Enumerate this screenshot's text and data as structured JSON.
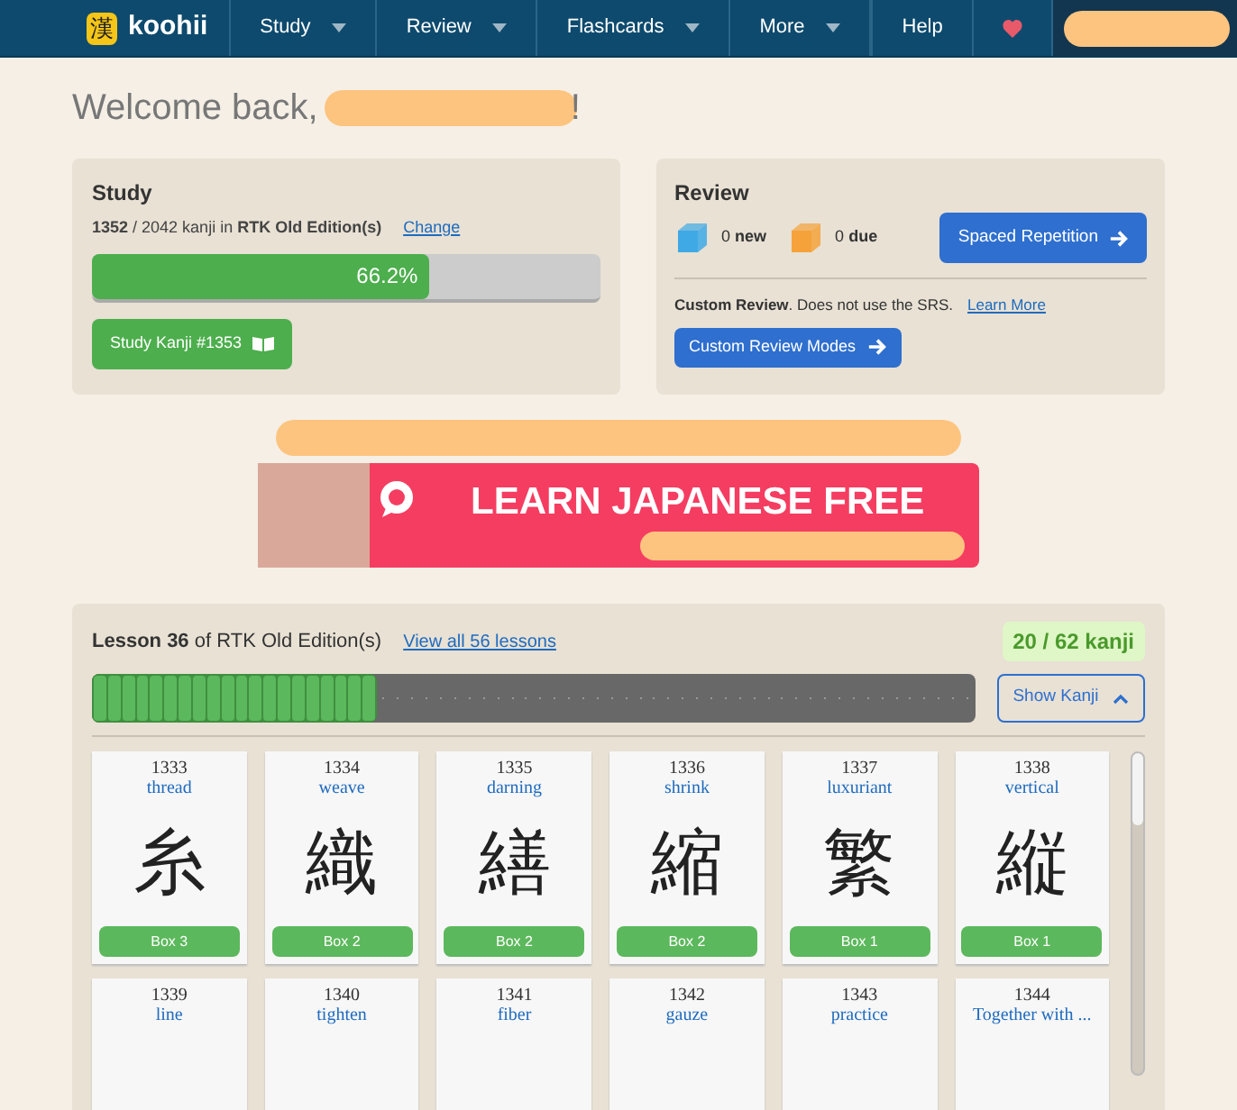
{
  "nav": {
    "logo_glyph": "漢",
    "brand": "koohii",
    "menus": [
      {
        "label": "Study"
      },
      {
        "label": "Review"
      },
      {
        "label": "Flashcards"
      },
      {
        "label": "More"
      }
    ],
    "help": "Help"
  },
  "welcome": {
    "greeting": "Welcome back,",
    "end": "!"
  },
  "study": {
    "title": "Study",
    "summary": "**1352** / 2042 kanji in **RTK Old Edition(s)**",
    "change_link": "Change",
    "level": 0.662,
    "percent": "66.2%",
    "button": "Study Kanji #1353"
  },
  "review": {
    "title": "Review",
    "counters": [
      {
        "count": "0",
        "label": "new",
        "color": "#3fa9e6"
      },
      {
        "count": "0",
        "label": "due",
        "color": "#f5a23a"
      }
    ],
    "srs_button": "Spaced Repetition",
    "custom_text": "**Custom Review**. Does not use the SRS.",
    "learn_more": "Learn More",
    "custom_button": "Custom Review Modes"
  },
  "ad": {
    "headline": "LEARN JAPANESE FREE"
  },
  "lesson": {
    "title": "**Lesson 36** of RTK Old Edition(s)",
    "view_all": "View all 56 lessons",
    "count": "20 / 62 kanji",
    "level": 0.3226,
    "show_button": "Show Kanji",
    "cards": [
      {
        "number": "1333",
        "keyword": "thread",
        "kanji": "糸",
        "box": "Box 3"
      },
      {
        "number": "1334",
        "keyword": "weave",
        "kanji": "織",
        "box": "Box 2"
      },
      {
        "number": "1335",
        "keyword": "darning",
        "kanji": "繕",
        "box": "Box 2"
      },
      {
        "number": "1336",
        "keyword": "shrink",
        "kanji": "縮",
        "box": "Box 2"
      },
      {
        "number": "1337",
        "keyword": "luxuriant",
        "kanji": "繁",
        "box": "Box 1"
      },
      {
        "number": "1338",
        "keyword": "vertical",
        "kanji": "縦",
        "box": "Box 1"
      },
      {
        "number": "1339",
        "keyword": "line"
      },
      {
        "number": "1340",
        "keyword": "tighten"
      },
      {
        "number": "1341",
        "keyword": "fiber"
      },
      {
        "number": "1342",
        "keyword": "gauze"
      },
      {
        "number": "1343",
        "keyword": "practice"
      },
      {
        "number": "1344",
        "keyword": "Together with ..."
      }
    ]
  }
}
